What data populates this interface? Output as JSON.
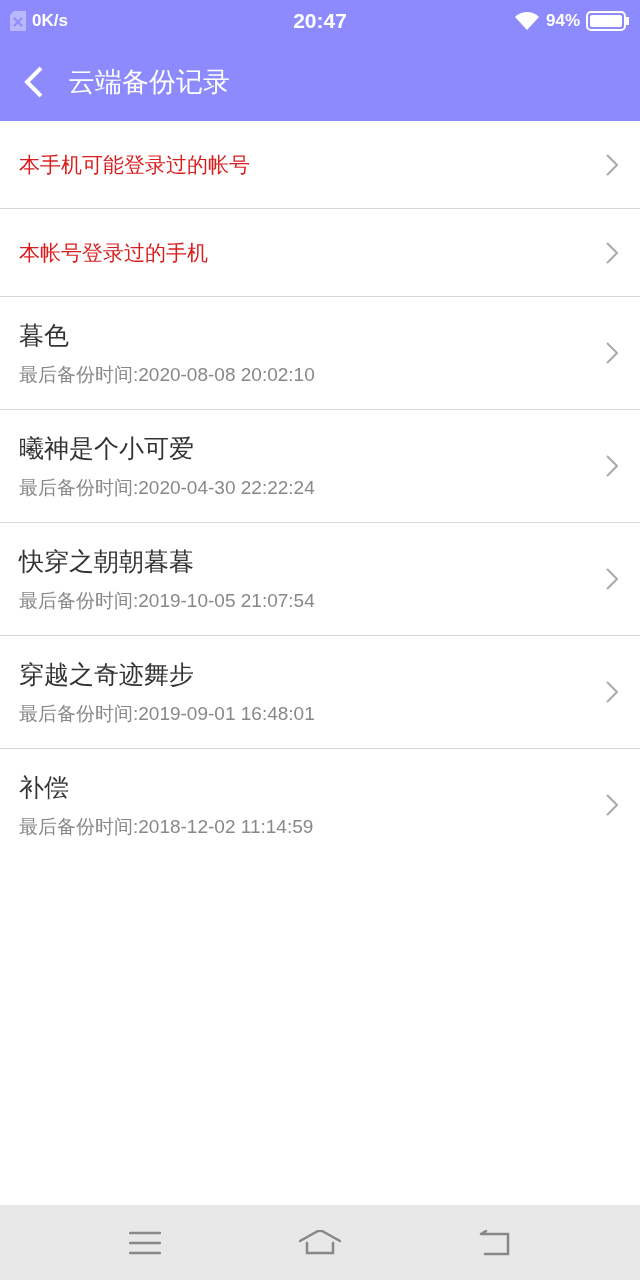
{
  "status_bar": {
    "network_speed": "0K/s",
    "time": "20:47",
    "battery": "94%"
  },
  "header": {
    "title": "云端备份记录"
  },
  "links": [
    {
      "label": "本手机可能登录过的帐号"
    },
    {
      "label": "本帐号登录过的手机"
    }
  ],
  "backups": [
    {
      "name": "暮色",
      "time": "最后备份时间:2020-08-08 20:02:10"
    },
    {
      "name": "曦神是个小可爱",
      "time": "最后备份时间:2020-04-30 22:22:24"
    },
    {
      "name": "快穿之朝朝暮暮",
      "time": "最后备份时间:2019-10-05 21:07:54"
    },
    {
      "name": "穿越之奇迹舞步",
      "time": "最后备份时间:2019-09-01 16:48:01"
    },
    {
      "name": "补偿",
      "time": "最后备份时间:2018-12-02 11:14:59"
    }
  ]
}
